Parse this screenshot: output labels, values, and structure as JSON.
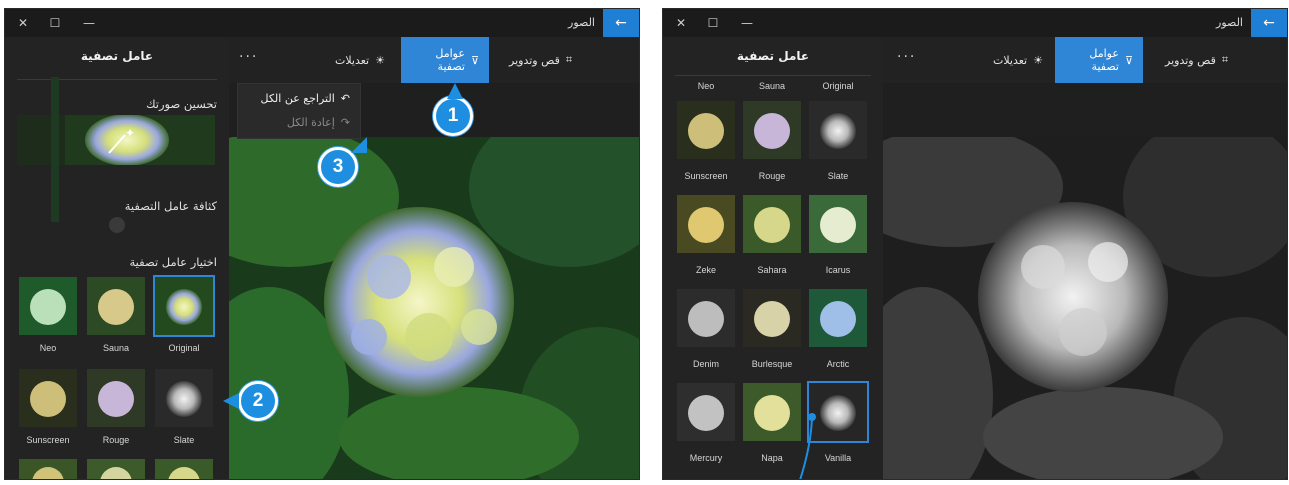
{
  "app_title": "الصور",
  "window_controls": {
    "close": "✕",
    "maximize": "☐",
    "minimize": "—",
    "back": "←"
  },
  "toolbar": {
    "crop": "قص وتدوير",
    "filters": "عوامل تصفية",
    "adjust": "تعديلات",
    "more": "···"
  },
  "undo_menu": {
    "undo_all": "التراجع عن الكل",
    "redo_all": "إعادة الكل"
  },
  "left_panel": {
    "title": "عامل تصفية",
    "enhance": "تحسين صورتك",
    "intensity": "كثافة عامل التصفية",
    "choose": "اختيار عامل تصفية",
    "filters": [
      "Original",
      "Sauna",
      "Neo",
      "Slate",
      "Rouge",
      "Sunscreen"
    ]
  },
  "right_panel": {
    "title": "عامل تصفية",
    "header_labels": [
      "Original",
      "Sauna",
      "Neo"
    ],
    "filters": [
      "Slate",
      "Rouge",
      "Sunscreen",
      "Icarus",
      "Sahara",
      "Zeke",
      "Arctic",
      "Burlesque",
      "Denim",
      "Vanilla",
      "Napa",
      "Mercury"
    ]
  },
  "callouts": [
    "1",
    "2",
    "3"
  ],
  "colors": {
    "accent": "#2f86d6",
    "badge": "#1e8fe0",
    "background": "#1f1f1f"
  }
}
